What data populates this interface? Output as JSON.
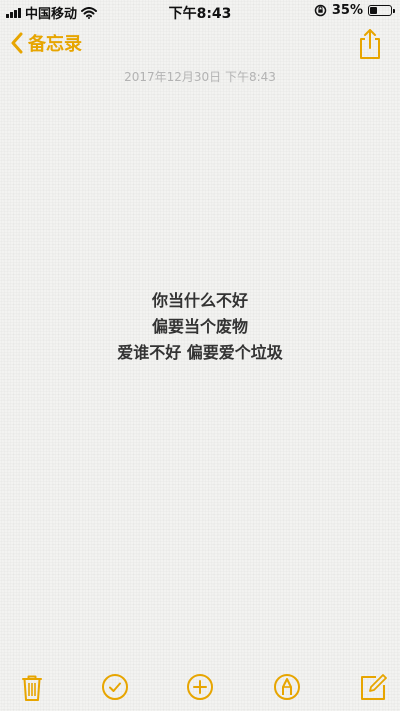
{
  "status_bar": {
    "carrier": "中国移动",
    "time": "下午8:43",
    "battery_text": "35%",
    "battery_level": 0.35
  },
  "nav": {
    "back_label": "备忘录",
    "back_icon": "chevron-left-icon",
    "share_icon": "share-icon"
  },
  "note": {
    "timestamp": "2017年12月30日 下午8:43",
    "lines": [
      "你当什么不好",
      "偏要当个废物",
      "爱谁不好 偏要爱个垃圾"
    ]
  },
  "toolbar": {
    "icons": [
      "trash-icon",
      "checklist-icon",
      "add-icon",
      "markup-icon",
      "compose-icon"
    ]
  },
  "colors": {
    "accent": "#e7a500",
    "background": "#f3f3f1",
    "timestamp": "#b3b3b3",
    "note_text": "#333333"
  }
}
